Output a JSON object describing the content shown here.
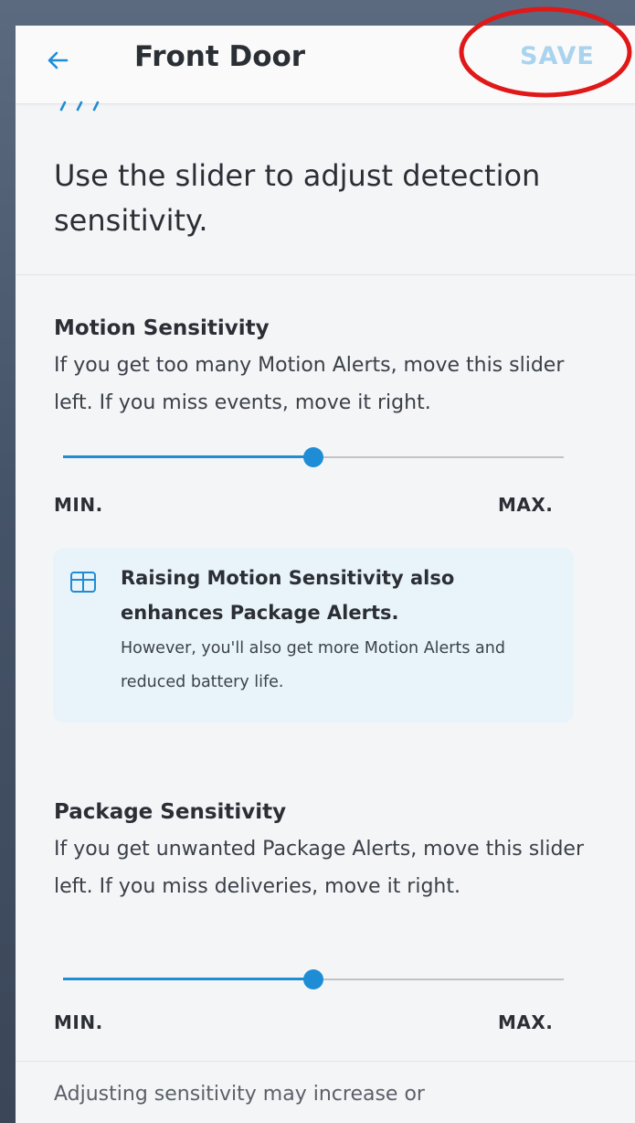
{
  "header": {
    "title": "Front Door",
    "save_label": "SAVE",
    "back_icon": "arrow-left-icon"
  },
  "intro": {
    "text": "Use the slider to adjust detection sensitivity."
  },
  "motion": {
    "title": "Motion Sensitivity",
    "description": "If you get too many Motion Alerts, move this slider left. If you miss events, move it right.",
    "slider_level": 0.5,
    "min_label": "MIN.",
    "max_label": "MAX."
  },
  "info": {
    "icon": "package-box-icon",
    "title": "Raising Motion Sensitivity also enhances Package Alerts.",
    "body": "However, you'll also get more Motion Alerts and reduced battery life."
  },
  "package": {
    "title": "Package Sensitivity",
    "description": "If you get unwanted Package Alerts, move this slider left. If you miss deliveries, move it right.",
    "slider_level": 0.5,
    "min_label": "MIN.",
    "max_label": "MAX."
  },
  "footer": {
    "text": "Adjusting sensitivity may increase or"
  },
  "colors": {
    "accent": "#1f8dd6",
    "save_disabled": "#a9d3ee",
    "annotation_red": "#e01818",
    "info_bg": "#e9f3fa"
  }
}
